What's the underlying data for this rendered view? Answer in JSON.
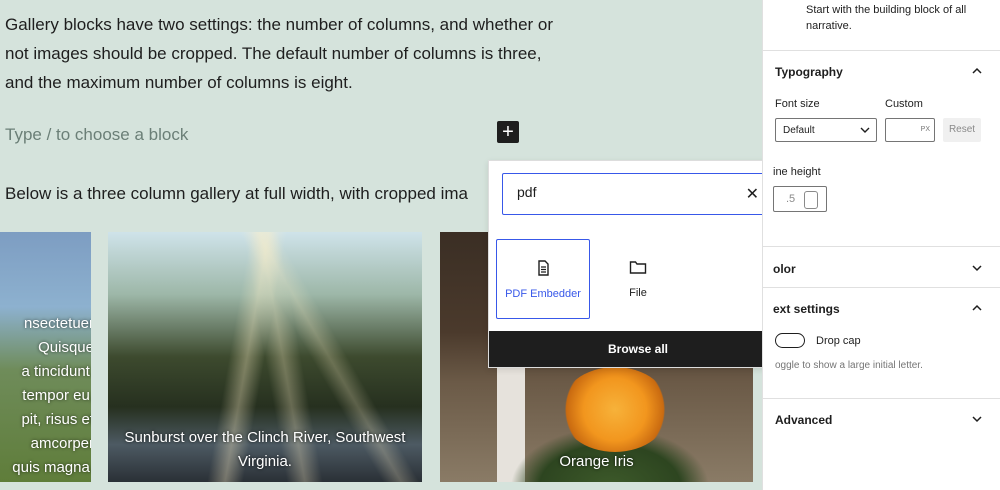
{
  "editor": {
    "paragraph1": "Gallery blocks have two settings: the number of columns, and whether or not images should be cropped. The default number of columns is three, and the maximum number of columns is eight.",
    "placeholder": "Type / to choose a block",
    "inserter_icon": "+",
    "paragraph2": "Below is a three column gallery at full width, with cropped ima",
    "gallery": {
      "item1_text_lines": [
        "nsectetuer",
        "Quisque",
        "a tincidunt.",
        "tempor eu,",
        "pit, risus et",
        "amcorper",
        "quis magna."
      ],
      "item2_caption": "Sunburst over the Clinch River,  Southwest Virginia.",
      "item3_caption": "Orange Iris"
    }
  },
  "inserter": {
    "search_value": "pdf",
    "clear_icon": "close-icon",
    "blocks": [
      {
        "label": "PDF Embedder",
        "icon": "document-icon"
      },
      {
        "label": "File",
        "icon": "folder-icon"
      }
    ],
    "browse_all": "Browse all"
  },
  "sidebar": {
    "description": "Start with the building block of all narrative.",
    "typography": {
      "title": "Typography",
      "font_size_label": "Font size",
      "custom_label": "Custom",
      "font_size_value": "Default",
      "custom_unit": "PX",
      "reset_label": "Reset",
      "line_height_label": "ine height",
      "line_height_value": ".5"
    },
    "color_title": "olor",
    "text_settings": {
      "title": "ext settings",
      "drop_cap_label": "Drop cap",
      "help": "oggle to show a large initial letter."
    },
    "advanced_title": "Advanced"
  },
  "colors": {
    "canvas": "#d5e3dc",
    "accent": "#3858e9",
    "dark": "#1e1e1e"
  }
}
